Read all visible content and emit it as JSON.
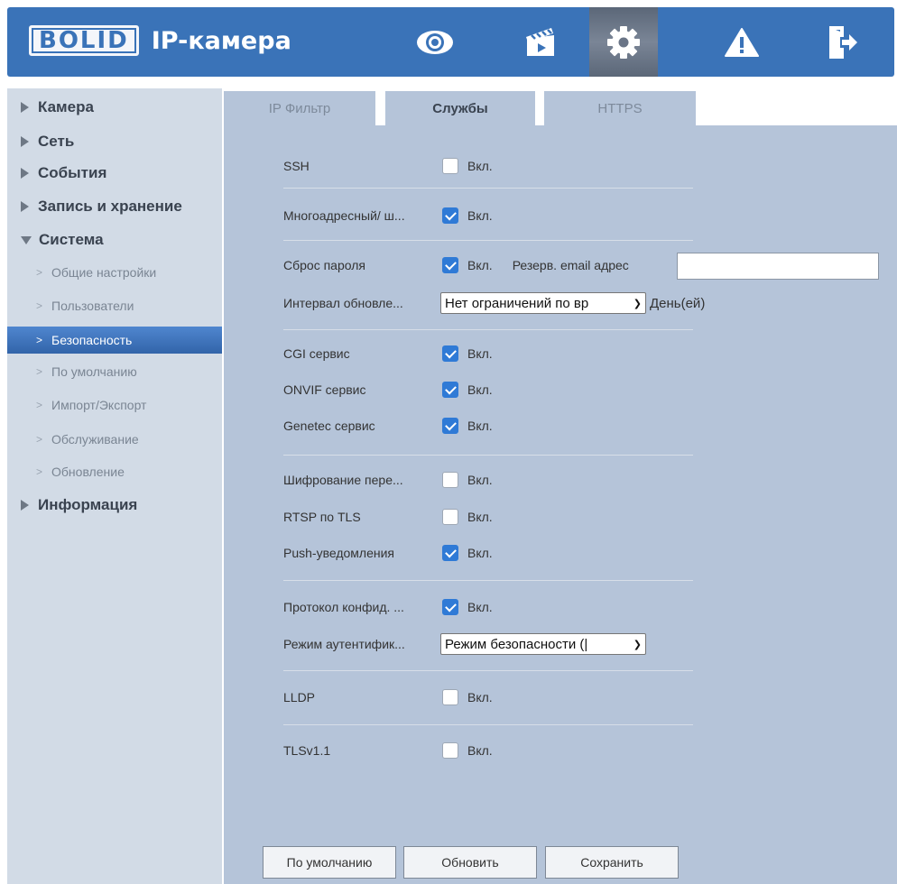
{
  "header": {
    "logo": "BOLID",
    "title": "IP-камера",
    "icons": [
      "eye-icon",
      "clapperboard-icon",
      "gear-icon",
      "warning-icon",
      "logout-icon"
    ],
    "active_icon": "gear-icon",
    "bg_color": "#3a73b8"
  },
  "sidebar": {
    "items": [
      {
        "label": "Камера"
      },
      {
        "label": "Сеть"
      },
      {
        "label": "События"
      },
      {
        "label": "Запись и хранение"
      },
      {
        "label": "Система"
      },
      {
        "label": "Информация"
      }
    ],
    "sub_items": [
      {
        "label": "Общие настройки"
      },
      {
        "label": "Пользователи"
      },
      {
        "label": "Безопасность"
      },
      {
        "label": "По умолчанию"
      },
      {
        "label": "Импорт/Экспорт"
      },
      {
        "label": "Обслуживание"
      },
      {
        "label": "Обновление"
      }
    ],
    "active_sub": "Безопасность",
    "active_color": "#3a73c0"
  },
  "tabs": [
    {
      "label": "IP Фильтр"
    },
    {
      "label": "Службы"
    },
    {
      "label": "HTTPS"
    }
  ],
  "active_tab": "Службы",
  "services": {
    "on_label": "Вкл.",
    "ssh": {
      "label": "SSH",
      "checked": false
    },
    "multicast": {
      "label": "Многоадресный/ ш...",
      "checked": true
    },
    "reset_password": {
      "label": "Сброс пароля",
      "checked": true,
      "email_label": "Резерв. email адрес",
      "email_value": ""
    },
    "update_interval": {
      "label": "Интервал обновле...",
      "selected": "Нет ограничений по вр",
      "unit": "День(ей)"
    },
    "cgi": {
      "label": "CGI сервис",
      "checked": true
    },
    "onvif": {
      "label": "ONVIF сервис",
      "checked": true
    },
    "genetec": {
      "label": "Genetec сервис",
      "checked": true
    },
    "encryption": {
      "label": "Шифрование пере...",
      "checked": false
    },
    "rtsp_tls": {
      "label": "RTSP по TLS",
      "checked": false
    },
    "push": {
      "label": "Push-уведомления",
      "checked": true
    },
    "privacy_protocol": {
      "label": "Протокол конфид. ...",
      "checked": true
    },
    "auth_mode": {
      "label": "Режим аутентифик...",
      "selected": "Режим безопасности (|"
    },
    "lldp": {
      "label": "LLDP",
      "checked": false
    },
    "tlsv11": {
      "label": "TLSv1.1",
      "checked": false
    }
  },
  "buttons": {
    "default": "По умолчанию",
    "refresh": "Обновить",
    "save": "Сохранить"
  },
  "checkbox_color": "#2f7ad6"
}
